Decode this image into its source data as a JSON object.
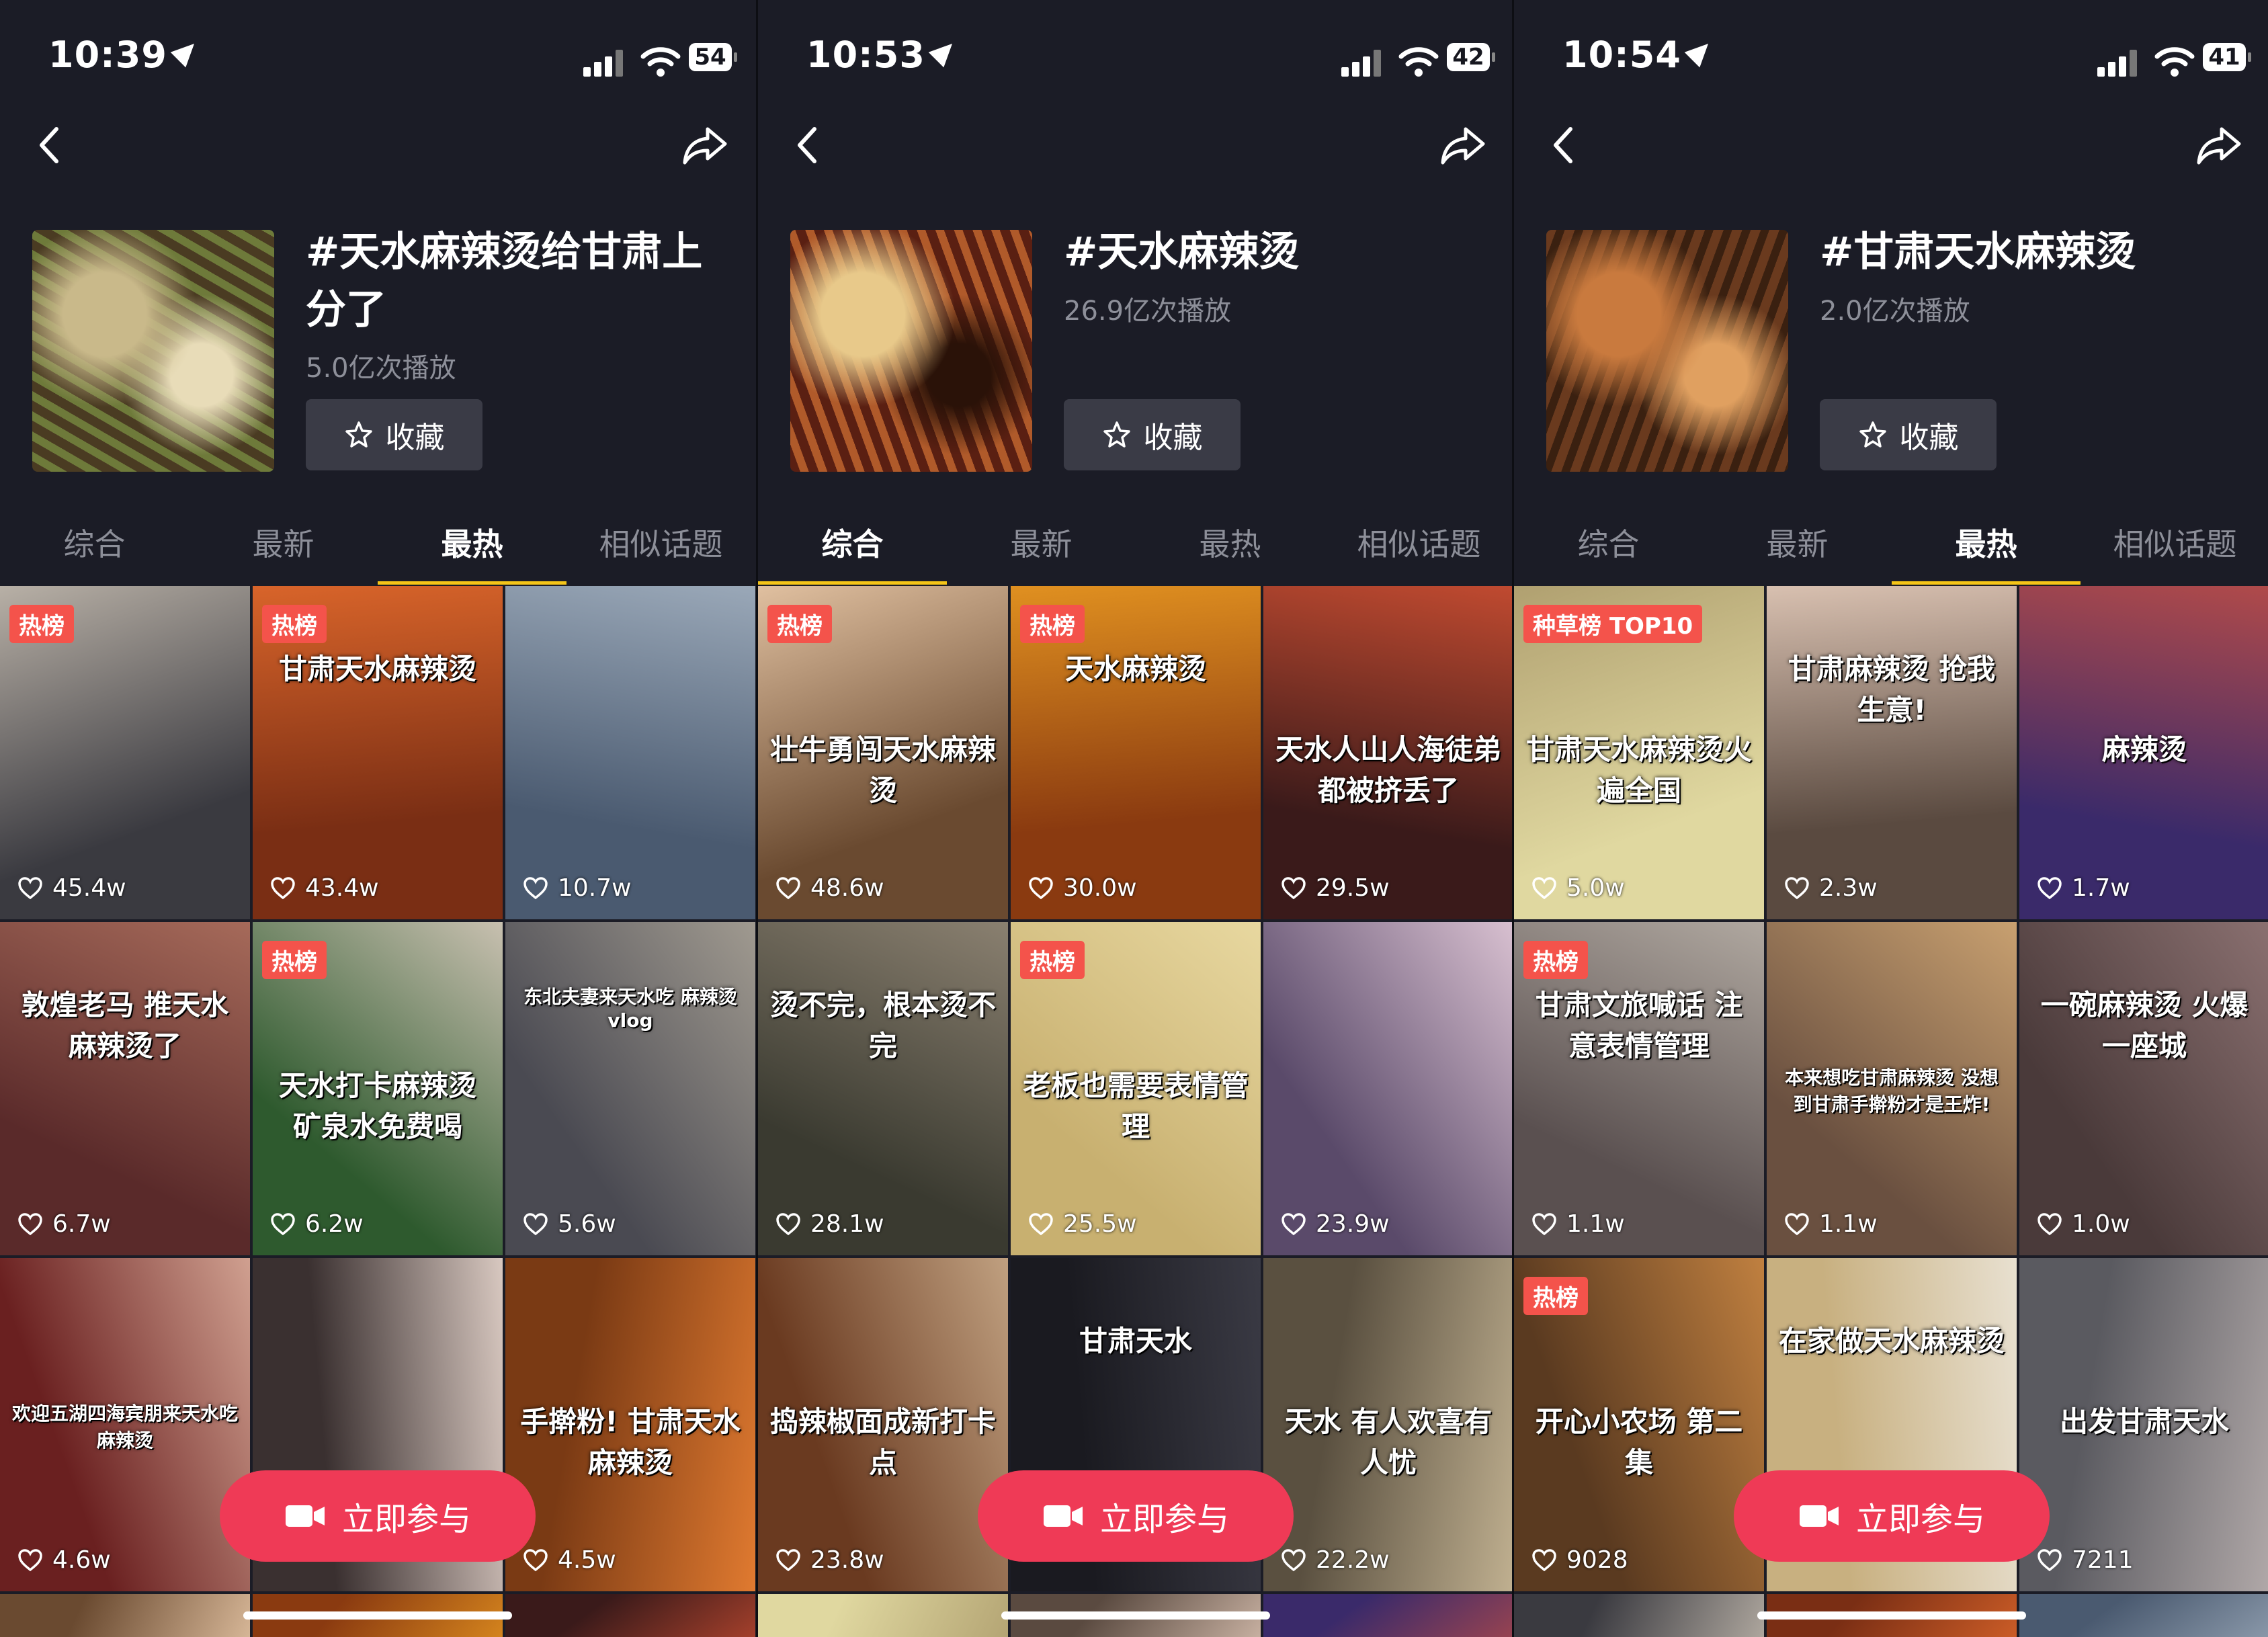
{
  "panels": [
    {
      "time": "10:39",
      "battery": "54",
      "title": "#天水麻辣烫给甘肃上分了",
      "plays": "5.0亿次播放",
      "fav_label": "收藏",
      "tabs": [
        "综合",
        "最新",
        "最热",
        "相似话题"
      ],
      "active_tab": 2,
      "join_label": "立即参与",
      "cells": [
        {
          "badge": "热榜",
          "caption": "",
          "likes": "45.4w"
        },
        {
          "badge": "热榜",
          "caption": "甘肃天水麻辣烫",
          "likes": "43.4w"
        },
        {
          "badge": "",
          "caption": "",
          "likes": "10.7w"
        },
        {
          "badge": "",
          "caption": "敦煌老马 推天水麻辣烫了",
          "likes": "6.7w"
        },
        {
          "badge": "热榜",
          "caption": "天水打卡麻辣烫 矿泉水免费喝",
          "likes": "6.2w"
        },
        {
          "badge": "",
          "caption": "东北夫妻来天水吃 麻辣烫vlog",
          "likes": "5.6w"
        },
        {
          "badge": "",
          "caption": "欢迎五湖四海宾朋来天水吃麻辣烫",
          "likes": "4.6w"
        },
        {
          "badge": "",
          "caption": "",
          "likes": ""
        },
        {
          "badge": "",
          "caption": "手擀粉! 甘肃天水麻辣烫",
          "likes": "4.5w"
        }
      ]
    },
    {
      "time": "10:53",
      "battery": "42",
      "title": "#天水麻辣烫",
      "plays": "26.9亿次播放",
      "fav_label": "收藏",
      "tabs": [
        "综合",
        "最新",
        "最热",
        "相似话题"
      ],
      "active_tab": 0,
      "join_label": "立即参与",
      "cells": [
        {
          "badge": "热榜",
          "caption": "壮牛勇闯天水麻辣烫",
          "likes": "48.6w"
        },
        {
          "badge": "热榜",
          "caption": "天水麻辣烫",
          "likes": "30.0w"
        },
        {
          "badge": "",
          "caption": "天水人山人海徒弟都被挤丢了",
          "likes": "29.5w"
        },
        {
          "badge": "",
          "caption": "烫不完，根本烫不完",
          "likes": "28.1w"
        },
        {
          "badge": "热榜",
          "caption": "老板也需要表情管理",
          "likes": "25.5w"
        },
        {
          "badge": "",
          "caption": "",
          "likes": "23.9w"
        },
        {
          "badge": "",
          "caption": "捣辣椒面成新打卡点",
          "likes": "23.8w"
        },
        {
          "badge": "",
          "caption": "甘肃天水",
          "likes": ""
        },
        {
          "badge": "",
          "caption": "天水 有人欢喜有人忧",
          "likes": "22.2w"
        }
      ]
    },
    {
      "time": "10:54",
      "battery": "41",
      "title": "#甘肃天水麻辣烫",
      "plays": "2.0亿次播放",
      "fav_label": "收藏",
      "tabs": [
        "综合",
        "最新",
        "最热",
        "相似话题"
      ],
      "active_tab": 2,
      "join_label": "立即参与",
      "cells": [
        {
          "badge": "种草榜 TOP10",
          "caption": "甘肃天水麻辣烫火遍全国",
          "likes": "5.0w"
        },
        {
          "badge": "",
          "caption": "甘肃麻辣烫 抢我生意!",
          "likes": "2.3w"
        },
        {
          "badge": "",
          "caption": "麻辣烫",
          "likes": "1.7w"
        },
        {
          "badge": "热榜",
          "caption": "甘肃文旅喊话 注意表情管理",
          "likes": "1.1w"
        },
        {
          "badge": "",
          "caption": "本来想吃甘肃麻辣烫 没想到甘肃手擀粉才是王炸!",
          "likes": "1.1w"
        },
        {
          "badge": "",
          "caption": "一碗麻辣烫 火爆一座城",
          "likes": "1.0w"
        },
        {
          "badge": "热榜",
          "caption": "开心小农场 第二集",
          "likes": "9028"
        },
        {
          "badge": "",
          "caption": "在家做天水麻辣烫",
          "likes": ""
        },
        {
          "badge": "",
          "caption": "出发甘肃天水",
          "likes": "7211"
        }
      ]
    }
  ],
  "colors": {
    "accent": "#f5c518",
    "join": "#ef3a56",
    "badge": "#f4534b"
  },
  "icons": [
    "location-icon",
    "signal-icon",
    "wifi-icon",
    "battery-icon",
    "back-icon",
    "share-icon",
    "star-icon",
    "heart-icon",
    "camera-icon"
  ]
}
